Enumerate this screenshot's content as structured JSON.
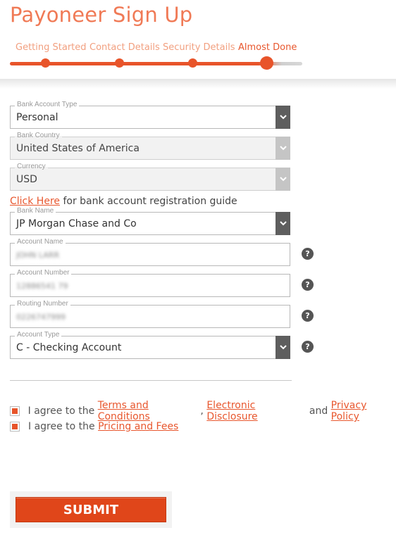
{
  "page": {
    "title": "Payoneer Sign Up"
  },
  "steps": [
    {
      "label": "Getting Started",
      "active": false
    },
    {
      "label": "Contact Details",
      "active": false
    },
    {
      "label": "Security Details",
      "active": false
    },
    {
      "label": "Almost Done",
      "active": true
    }
  ],
  "form": {
    "bank_account_type": {
      "label": "Bank Account Type",
      "value": "Personal"
    },
    "bank_country": {
      "label": "Bank Country",
      "value": "United States of America"
    },
    "currency": {
      "label": "Currency",
      "value": "USD"
    },
    "guide": {
      "link": "Click Here",
      "text": " for bank account registration guide"
    },
    "bank_name": {
      "label": "Bank Name",
      "value": "JP Morgan Chase and Co"
    },
    "account_name": {
      "label": "Account Name",
      "value": "JOHN LARR"
    },
    "account_number": {
      "label": "Account Number",
      "value": "12886541 79"
    },
    "routing_number": {
      "label": "Routing Number",
      "value": "0226747999"
    },
    "account_type": {
      "label": "Account Type",
      "value": "C - Checking Account"
    },
    "help_symbol": "?"
  },
  "agreements": {
    "terms": {
      "prefix": "I agree to the ",
      "link1": "Terms and Conditions",
      "sep": ", ",
      "link2": "Electronic Disclosure",
      "and": " and ",
      "link3": "Privacy Policy"
    },
    "pricing": {
      "prefix": "I agree to the ",
      "link": "Pricing and Fees"
    }
  },
  "actions": {
    "submit_label": "SUBMIT"
  },
  "colors": {
    "accent": "#e8542a",
    "dark_dropdown": "#5e5e5e",
    "disabled_dropdown": "#c5c5c5"
  }
}
